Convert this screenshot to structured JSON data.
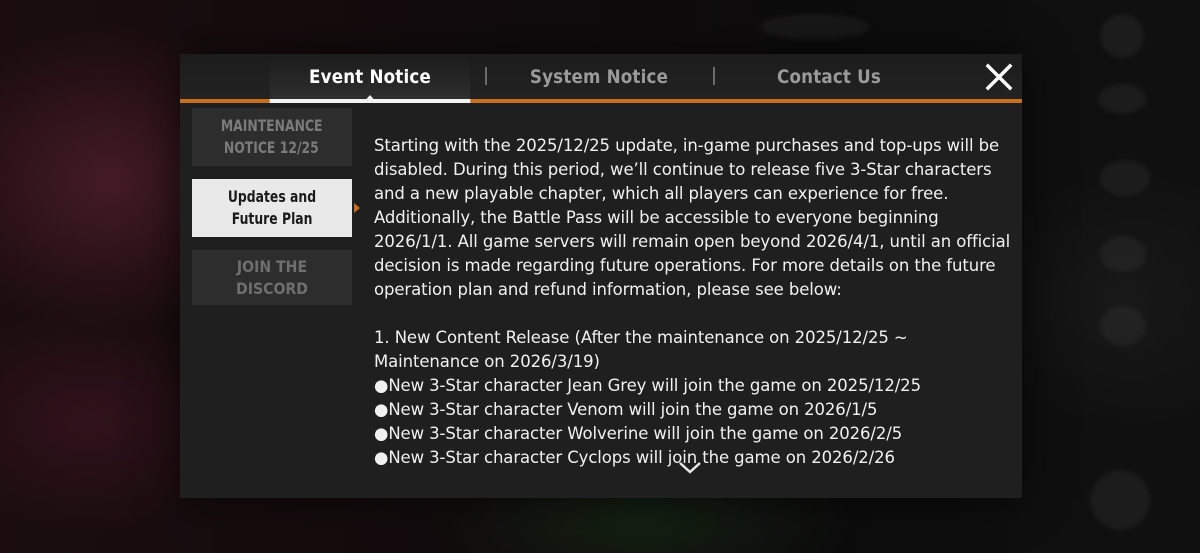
{
  "tabs": [
    {
      "label": "Event Notice",
      "active": true
    },
    {
      "label": "System Notice",
      "active": false
    },
    {
      "label": "Contact Us",
      "active": false
    }
  ],
  "sidebar": {
    "items": [
      {
        "label_line1": "MAINTENANCE",
        "label_line2": "NOTICE 12/25",
        "active": false
      },
      {
        "label_line1": "Updates and",
        "label_line2": "Future Plan",
        "active": true
      },
      {
        "label_line1": "JOIN THE DISCORD",
        "active": false
      }
    ]
  },
  "content": {
    "intro": "Starting with the 2025/12/25 update, in-game purchases and top-ups will be disabled. During this period, we’ll continue to release five 3-Star characters and a new playable chapter, which all players can experience for free. Additionally, the Battle Pass will be accessible to everyone beginning 2026/1/1. All game servers will remain open beyond 2026/4/1, until an official decision is made regarding future operations. For more details on the future operation plan and refund information, please see below:",
    "section1_title": "1. New Content Release (After the maintenance on 2025/12/25 ~ Maintenance on 2026/3/19)",
    "bullets": [
      "New 3-Star character Jean Grey will join the game on 2025/12/25",
      "New 3-Star character Venom will join the game on 2026/1/5",
      "New 3-Star character Wolverine will join the game on 2026/2/5",
      "New 3-Star character Cyclops will join the game on 2026/2/26"
    ]
  },
  "icons": {
    "close": "close-icon",
    "scroll": "chevron-down-icon"
  },
  "colors": {
    "accent": "#c8701e",
    "panel": "#1f1f1f",
    "active_side": "#e9e9e9"
  }
}
